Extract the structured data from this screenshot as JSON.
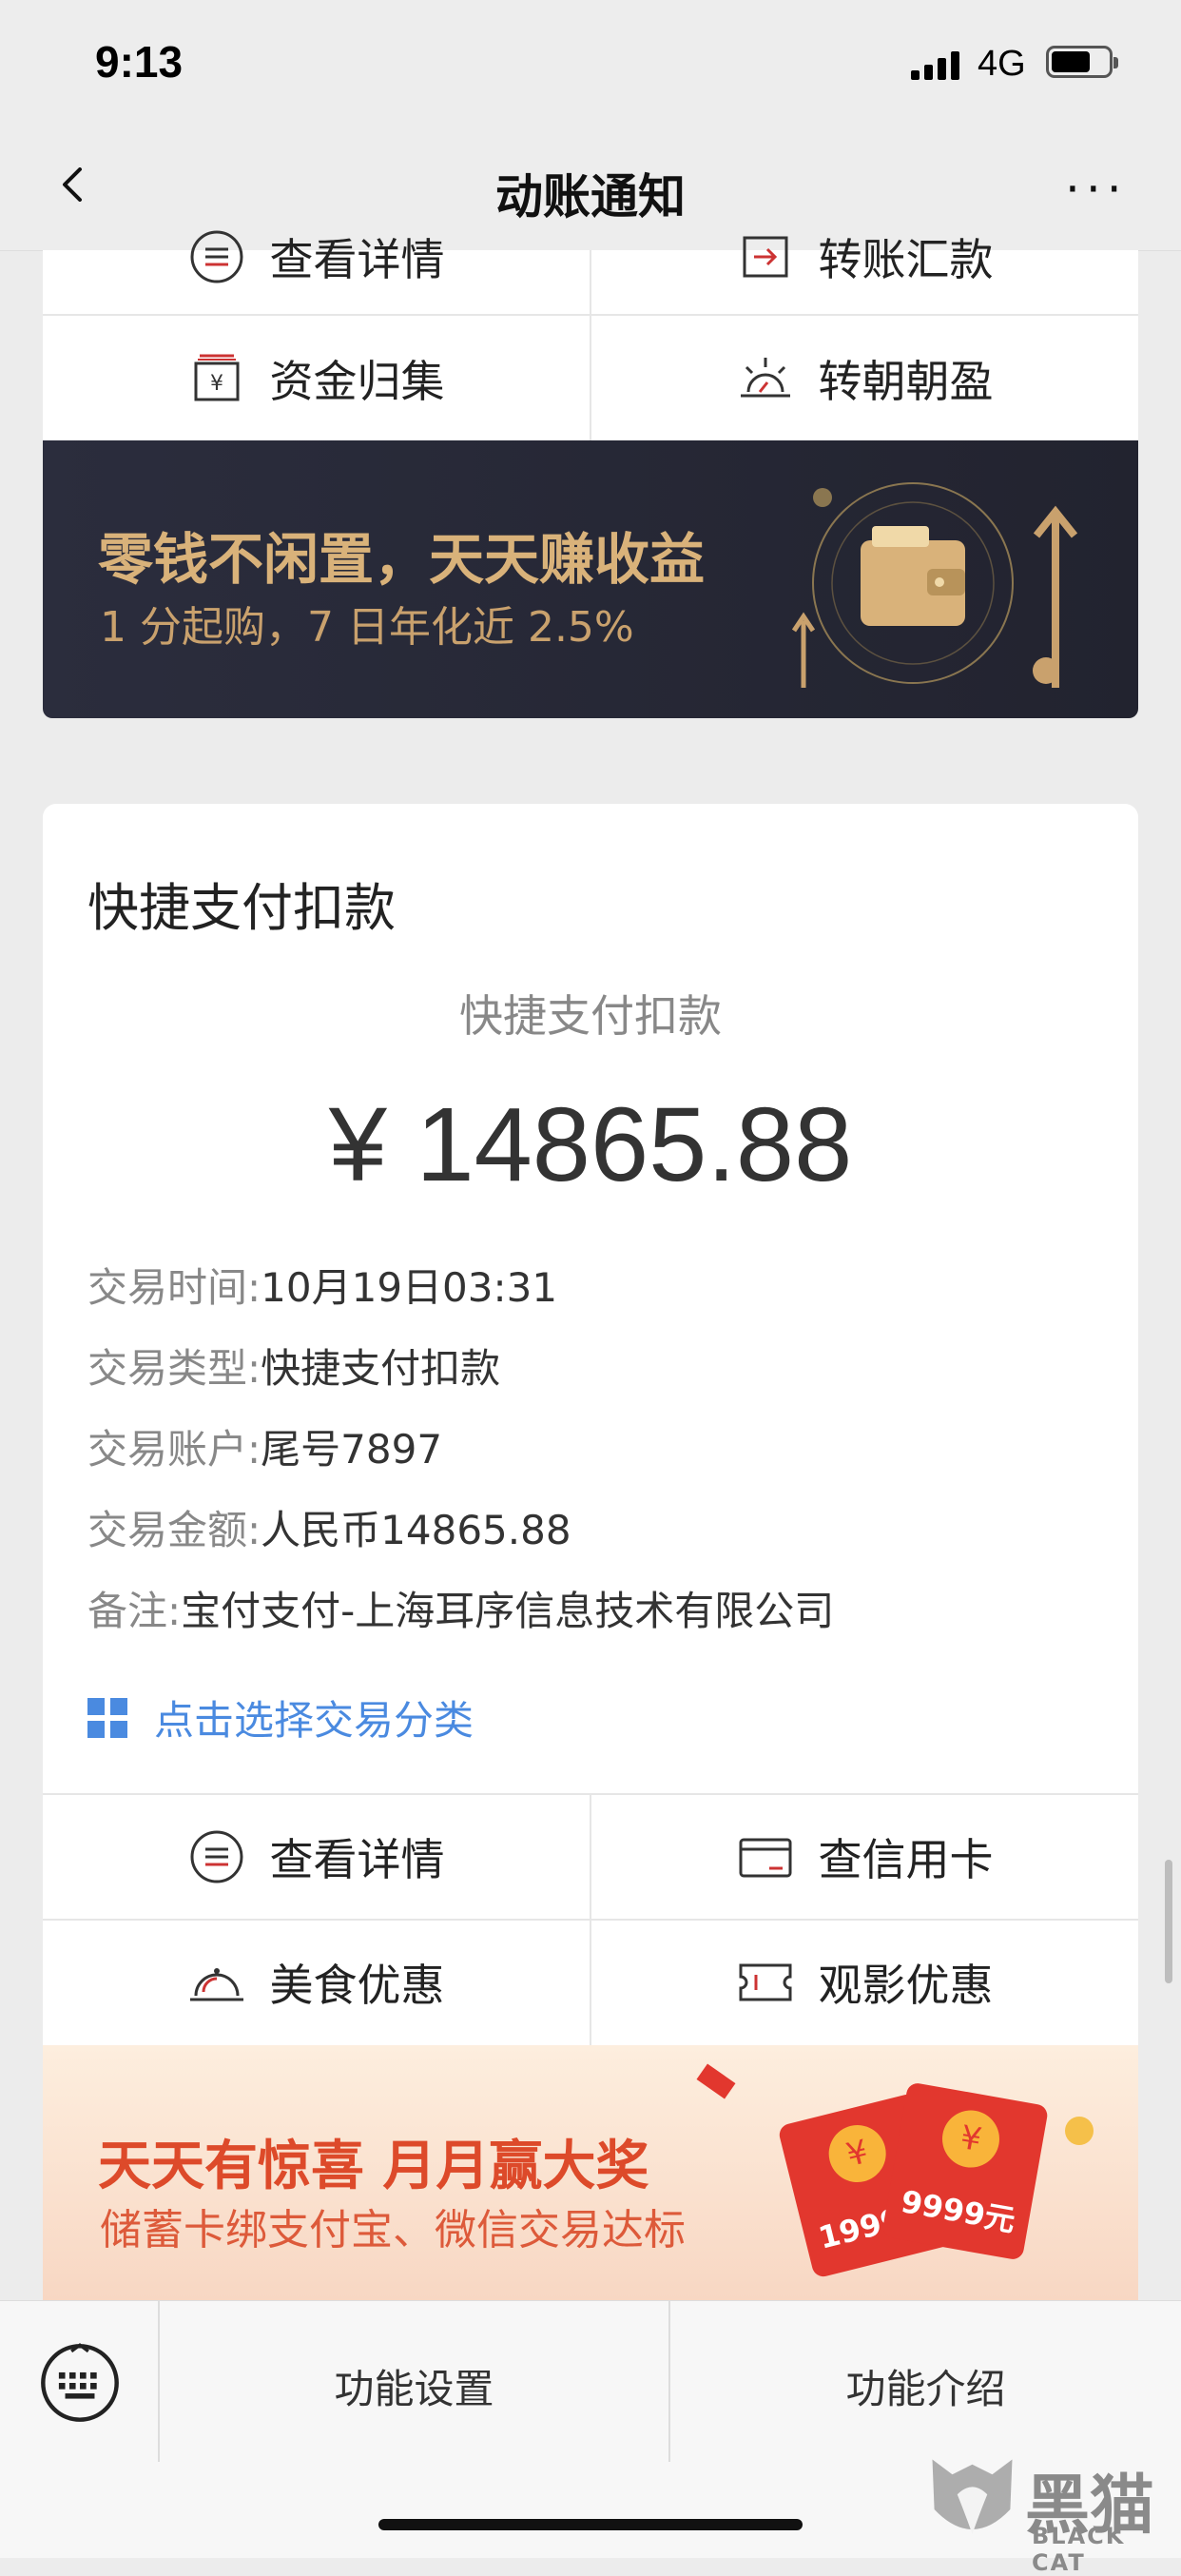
{
  "status_bar": {
    "time": "9:13",
    "network": "4G"
  },
  "nav": {
    "title": "动账通知",
    "more": "···"
  },
  "top_card": {
    "cells": [
      {
        "label": "查看详情"
      },
      {
        "label": "转账汇款"
      },
      {
        "label": "资金归集"
      },
      {
        "label": "转朝朝盈"
      }
    ]
  },
  "promo_dark": {
    "title": "零钱不闲置，天天赚收益",
    "subtitle": "1 分起购，7 日年化近 2.5%"
  },
  "detail": {
    "header": "快捷支付扣款",
    "type_caption": "快捷支付扣款",
    "amount": "¥ 14865.88",
    "rows": [
      {
        "label": "交易时间:",
        "value": "10月19日03:31"
      },
      {
        "label": "交易类型:",
        "value": "快捷支付扣款"
      },
      {
        "label": "交易账户:",
        "value": "尾号7897"
      },
      {
        "label": "交易金额:",
        "value": "人民币14865.88"
      },
      {
        "label": "备注:",
        "value": "宝付支付-上海耳序信息技术有限公司"
      }
    ],
    "classify_link": "点击选择交易分类",
    "actions": [
      {
        "label": "查看详情"
      },
      {
        "label": "查信用卡"
      },
      {
        "label": "美食优惠"
      },
      {
        "label": "观影优惠"
      }
    ]
  },
  "promo_red": {
    "title": "天天有惊喜 月月赢大奖",
    "subtitle": "储蓄卡绑支付宝、微信交易达标",
    "envelope1": "1999元",
    "envelope2": "9999元",
    "coin": "¥"
  },
  "bottom_bar": {
    "settings": "功能设置",
    "intro": "功能介绍"
  },
  "watermark": {
    "text": "黑猫",
    "sub": "BLACK CAT"
  }
}
